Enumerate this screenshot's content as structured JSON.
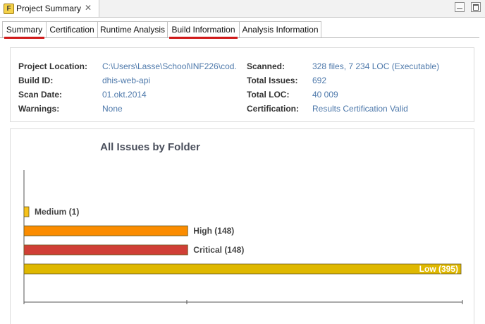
{
  "view": {
    "title": "Project Summary",
    "icon_letter": "F",
    "close_icon": "✕"
  },
  "window_controls": [
    "minimize-icon",
    "maximize-icon"
  ],
  "tabs": [
    {
      "label": "Summary",
      "active": true,
      "underlined": true
    },
    {
      "label": "Certification"
    },
    {
      "label": "Runtime Analysis"
    },
    {
      "label": "Build Information",
      "underlined": true
    },
    {
      "label": "Analysis Information"
    }
  ],
  "info": {
    "left": [
      {
        "label": "Project Location:",
        "value": "C:\\Users\\Lasse\\School\\INF226\\cod."
      },
      {
        "label": "Build ID:",
        "value": "dhis-web-api"
      },
      {
        "label": "Scan Date:",
        "value": "01.okt.2014"
      },
      {
        "label": "Warnings:",
        "value": "None"
      }
    ],
    "right": [
      {
        "label": "Scanned:",
        "value": "328 files, 7 234 LOC (Executable)"
      },
      {
        "label": "Total Issues:",
        "value": "692"
      },
      {
        "label": "Total LOC:",
        "value": "40 009"
      },
      {
        "label": "Certification:",
        "value": "Results Certification Valid"
      }
    ]
  },
  "colors": {
    "value_link": "#4e79ab",
    "tab_underline": "#d01a1a"
  },
  "chart_data": {
    "type": "bar",
    "orientation": "horizontal",
    "title": "All Issues by Folder",
    "categories": [
      "Medium",
      "High",
      "Critical",
      "Low"
    ],
    "values": [
      1,
      148,
      148,
      395
    ],
    "labels": [
      "Medium (1)",
      "High (148)",
      "Critical (148)",
      "Low (395)"
    ],
    "colors": [
      "#f7c21b",
      "#fb8c00",
      "#d03f36",
      "#dfb800"
    ],
    "xlim": [
      0,
      395
    ],
    "grid": false
  }
}
